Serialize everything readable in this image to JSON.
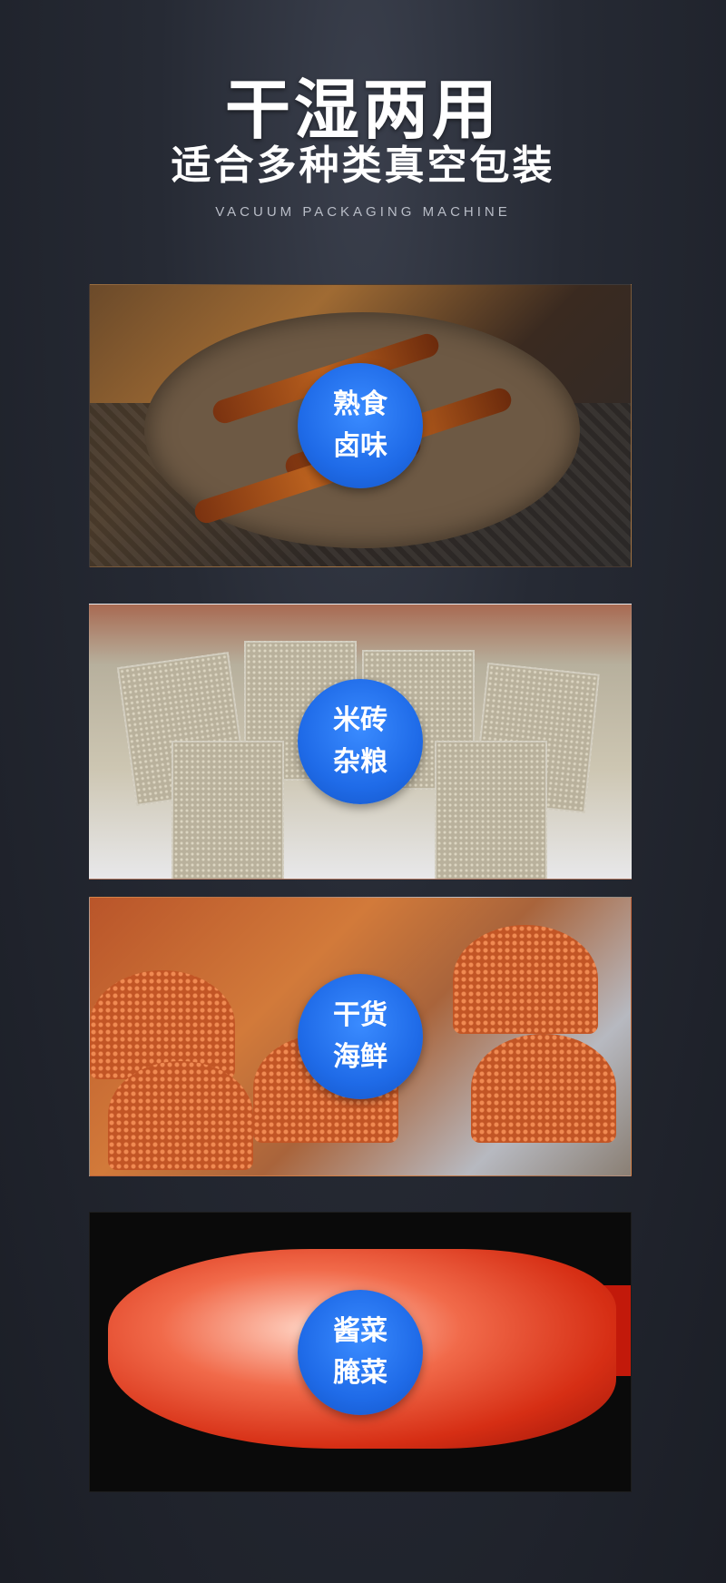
{
  "header": {
    "title": "干湿两用",
    "subtitle": "适合多种类真空包装",
    "english": "VACUUM PACKAGING MACHINE"
  },
  "panels": [
    {
      "line1": "熟食",
      "line2": "卤味"
    },
    {
      "line1": "米砖",
      "line2": "杂粮"
    },
    {
      "line1": "干货",
      "line2": "海鲜"
    },
    {
      "line1": "酱菜",
      "line2": "腌菜"
    }
  ],
  "colors": {
    "background": "#262a34",
    "badge": "#1f6be8",
    "text": "#ffffff"
  }
}
